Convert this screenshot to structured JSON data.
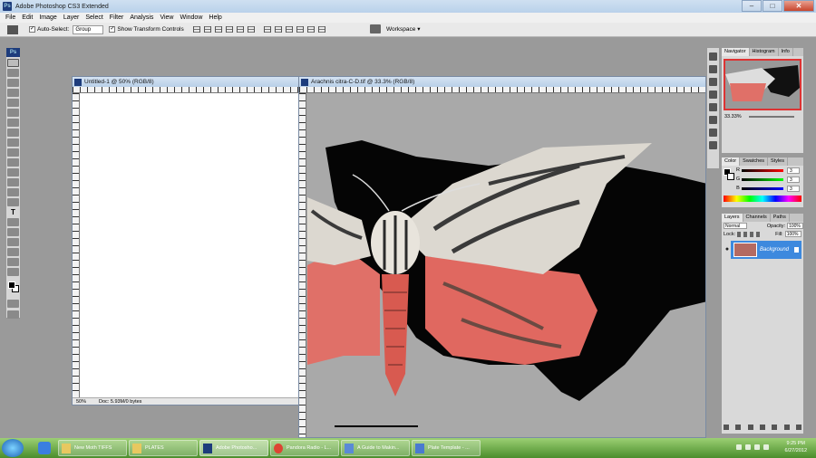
{
  "app": {
    "title": "Adobe Photoshop CS3 Extended",
    "logo": "Ps"
  },
  "window_buttons": {
    "minimize": "–",
    "maximize": "□",
    "close": "✕"
  },
  "menu": [
    "File",
    "Edit",
    "Image",
    "Layer",
    "Select",
    "Filter",
    "Analysis",
    "View",
    "Window",
    "Help"
  ],
  "options": {
    "auto_select_label": "Auto-Select:",
    "auto_select_value": "Group",
    "show_transform_label": "Show Transform Controls",
    "workspace_label": "Workspace ▾"
  },
  "docs": {
    "untitled": {
      "title": "Untitled-1 @ 50% (RGB/8)",
      "zoom": "50%",
      "doc_size": "Doc: 5.93M/0 bytes"
    },
    "moth": {
      "title": "Arachnis citra-C-D.tif @ 33.3% (RGB/8)"
    }
  },
  "panels": {
    "navigator": {
      "tabs": [
        "Navigator",
        "Histogram",
        "Info"
      ],
      "zoom": "33.33%"
    },
    "color": {
      "tabs": [
        "Color",
        "Swatches",
        "Styles"
      ],
      "channels": [
        "R",
        "G",
        "B"
      ],
      "values": [
        "3",
        "3",
        "3"
      ]
    },
    "layers": {
      "tabs": [
        "Layers",
        "Channels",
        "Paths"
      ],
      "blend_mode": "Normal",
      "opacity_label": "Opacity:",
      "opacity_value": "100%",
      "lock_label": "Lock:",
      "fill_label": "Fill:",
      "fill_value": "100%",
      "layer_name": "Background"
    }
  },
  "taskbar": {
    "buttons": [
      {
        "label": "New Moth TIFFS",
        "color": "#e8c860"
      },
      {
        "label": "PLATES",
        "color": "#e8c860"
      },
      {
        "label": "Adobe Photosho...",
        "color": "#1d3c7c"
      },
      {
        "label": "Pandora Radio - L...",
        "color": "#dd4433"
      },
      {
        "label": "A Guide to Makin...",
        "color": "#5a8ad6"
      },
      {
        "label": "Plate Template - ...",
        "color": "#4a7ad0"
      }
    ],
    "time": "9:25 PM",
    "date": "6/27/2012"
  }
}
